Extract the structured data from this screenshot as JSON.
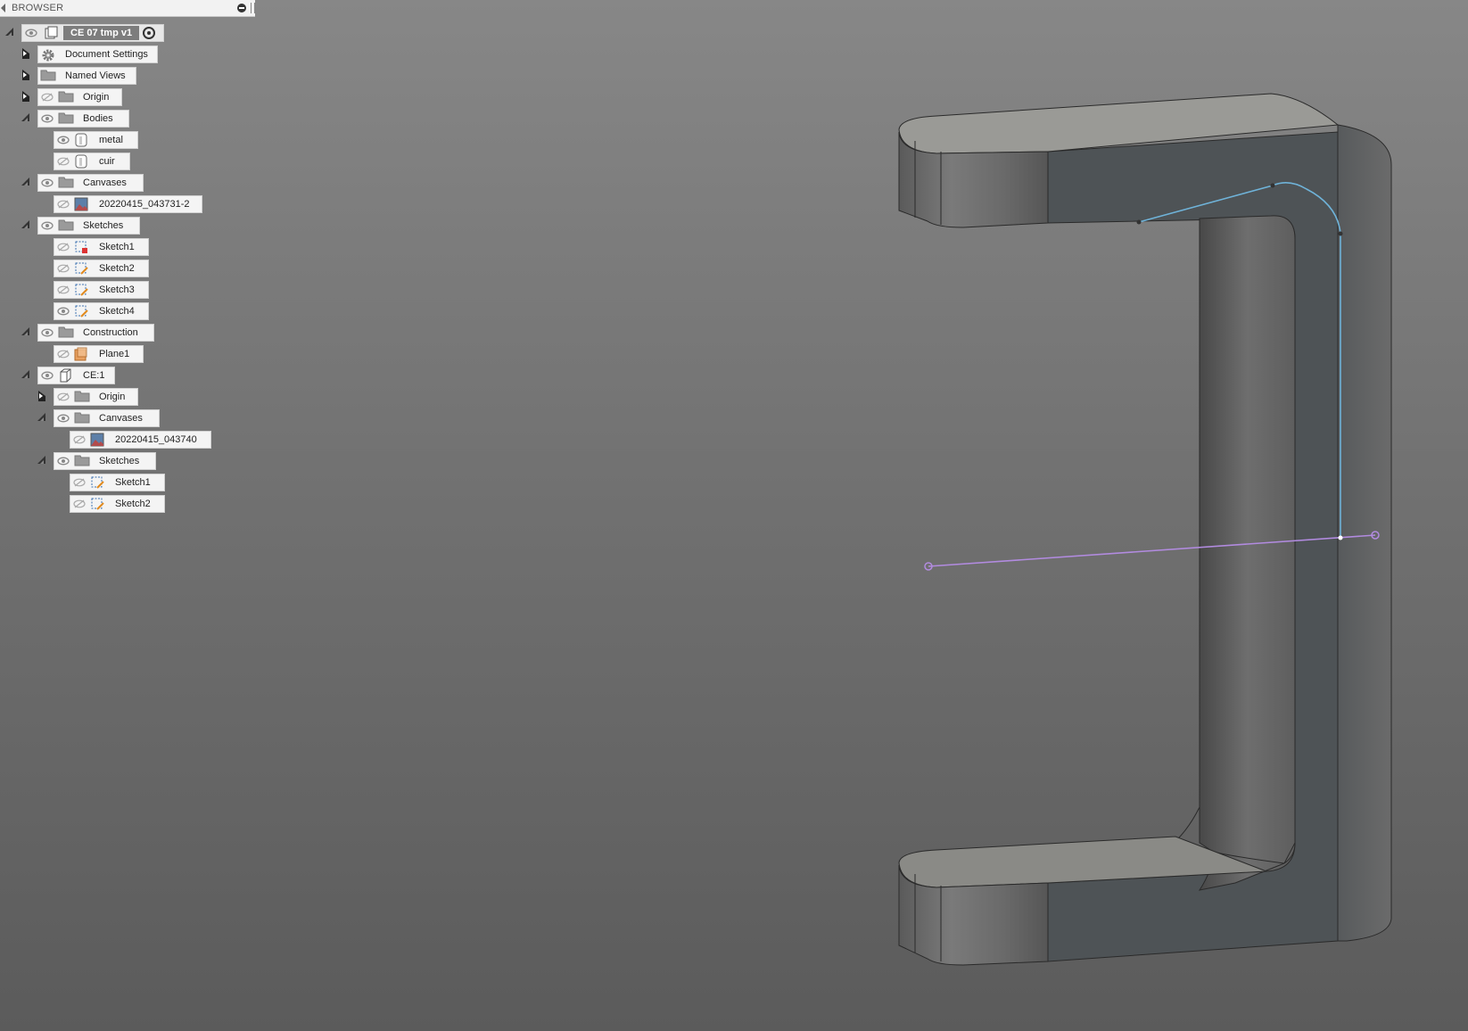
{
  "browser": {
    "title": "BROWSER",
    "items": [
      {
        "name": "root-component",
        "label": "CE 07 tmp v1",
        "toggle": "expanded"
      },
      {
        "name": "document-settings",
        "label": "Document Settings",
        "toggle": "collapsed",
        "icon": "gear-icon"
      },
      {
        "name": "named-views",
        "label": "Named Views",
        "toggle": "collapsed",
        "icon": "folder-icon"
      },
      {
        "name": "origin",
        "label": "Origin",
        "toggle": "collapsed",
        "icon": "folder-icon",
        "visible": false
      },
      {
        "name": "bodies",
        "label": "Bodies",
        "toggle": "expanded",
        "icon": "folder-icon",
        "visible": true
      },
      {
        "name": "body-metal",
        "label": "metal",
        "icon": "body-icon",
        "visible": true
      },
      {
        "name": "body-cuir",
        "label": "cuir",
        "icon": "body-icon",
        "visible": false
      },
      {
        "name": "canvases",
        "label": "Canvases",
        "toggle": "expanded",
        "icon": "folder-icon",
        "visible": true
      },
      {
        "name": "canvas-1",
        "label": "20220415_043731-2",
        "icon": "canvas-icon",
        "visible": false
      },
      {
        "name": "sketches",
        "label": "Sketches",
        "toggle": "expanded",
        "icon": "folder-icon",
        "visible": true
      },
      {
        "name": "sketch-1",
        "label": "Sketch1",
        "icon": "sketch-locked-icon",
        "visible": false
      },
      {
        "name": "sketch-2",
        "label": "Sketch2",
        "icon": "sketch-icon",
        "visible": false
      },
      {
        "name": "sketch-3",
        "label": "Sketch3",
        "icon": "sketch-icon",
        "visible": false
      },
      {
        "name": "sketch-4",
        "label": "Sketch4",
        "icon": "sketch-icon",
        "visible": true
      },
      {
        "name": "construction",
        "label": "Construction",
        "toggle": "expanded",
        "icon": "folder-icon",
        "visible": true
      },
      {
        "name": "plane-1",
        "label": "Plane1",
        "icon": "plane-icon",
        "visible": false
      },
      {
        "name": "component-ce1",
        "label": "CE:1",
        "toggle": "expanded",
        "icon": "component-icon",
        "visible": true
      },
      {
        "name": "ce1-origin",
        "label": "Origin",
        "toggle": "collapsed",
        "icon": "folder-icon",
        "visible": false
      },
      {
        "name": "ce1-canvases",
        "label": "Canvases",
        "toggle": "expanded",
        "icon": "folder-icon",
        "visible": true
      },
      {
        "name": "ce1-canvas-1",
        "label": "20220415_043740",
        "icon": "canvas-icon",
        "visible": false
      },
      {
        "name": "ce1-sketches",
        "label": "Sketches",
        "toggle": "expanded",
        "icon": "folder-icon",
        "visible": true
      },
      {
        "name": "ce1-sketch-1",
        "label": "Sketch1",
        "icon": "sketch-icon",
        "visible": false
      },
      {
        "name": "ce1-sketch-2",
        "label": "Sketch2",
        "icon": "sketch-icon",
        "visible": false
      }
    ]
  },
  "colors": {
    "sketch_line": "#6fb3d9",
    "construction_line": "#b28be0",
    "body_dark": "#4e5356",
    "body_top": "#9a9a96"
  }
}
